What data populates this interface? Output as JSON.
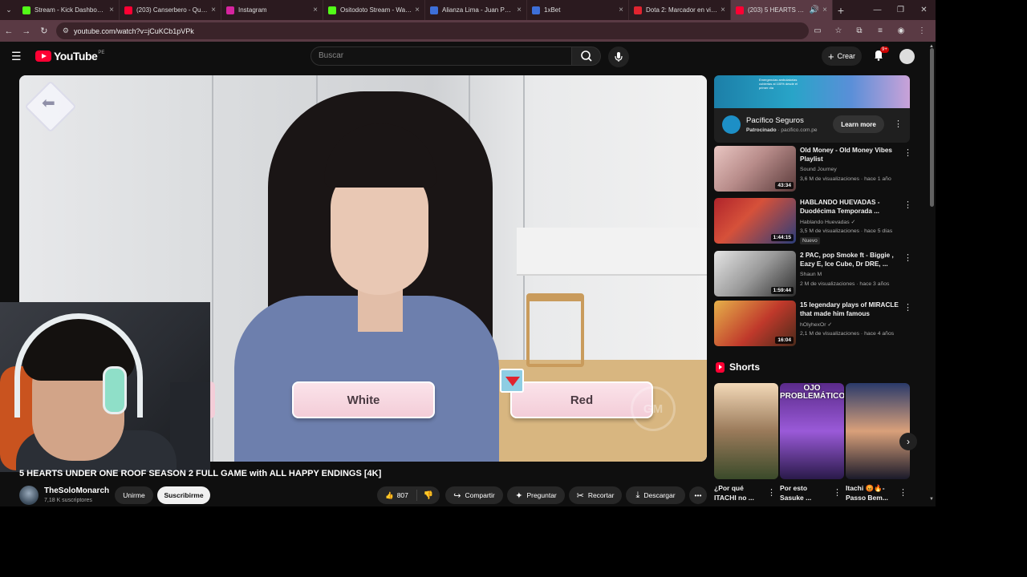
{
  "browser": {
    "tabs": [
      {
        "title": "Stream - Kick Dashboard",
        "icon": "kick-icon",
        "color": "#53fc18"
      },
      {
        "title": "(203) Canserbero - Quer...",
        "icon": "youtube-icon",
        "color": "#ff0033"
      },
      {
        "title": "Instagram",
        "icon": "instagram-icon",
        "color": "#d6249f"
      },
      {
        "title": "Ositodoto Stream - Watc...",
        "icon": "kick-icon",
        "color": "#53fc18"
      },
      {
        "title": "Alianza Lima - Juan Pablo...",
        "icon": "site-icon",
        "color": "#3d6fd8"
      },
      {
        "title": "1xBet",
        "icon": "site-icon",
        "color": "#3d6fd8"
      },
      {
        "title": "Dota 2: Marcador en vivo...",
        "icon": "site-icon",
        "color": "#e0242f"
      },
      {
        "title": "(203) 5 HEARTS UNDE...",
        "icon": "youtube-icon",
        "color": "#ff0033"
      }
    ],
    "url": "youtube.com/watch?v=jCuKCb1pVPk"
  },
  "yt": {
    "logo_text": "YouTube",
    "country": "PE",
    "search_placeholder": "Buscar",
    "create_label": "Crear",
    "notif_count": "9+"
  },
  "player": {
    "choice_left": "White",
    "choice_right": "Red",
    "watermark": "GM"
  },
  "video": {
    "title": "5 HEARTS UNDER ONE ROOF SEASON 2 FULL GAME with ALL HAPPY ENDINGS [4K]",
    "channel": "TheSoloMonarch",
    "subs": "7,18 K suscriptores",
    "join": "Unirme",
    "subscribe": "Suscribirme",
    "likes": "807",
    "share": "Compartir",
    "ask": "Preguntar",
    "clip": "Recortar",
    "download": "Descargar"
  },
  "ad": {
    "title": "Pacífico Seguros",
    "sponsored": "Patrocinado",
    "domain": "pacifico.com.pe",
    "cta": "Learn more",
    "banner_text": "Emergencias ambulatorias cubiertas al 100% desde el primer día"
  },
  "recs": [
    {
      "title": "Old Money - Old Money Vibes Playlist",
      "channel": "Sound Journey",
      "meta": "3,6 M de visualizaciones · hace 1 año",
      "duration": "43:34",
      "badge": ""
    },
    {
      "title": "HABLANDO HUEVADAS - Duodécima Temporada ...",
      "channel": "Hablando Huevadas ✓",
      "meta": "3,5 M de visualizaciones · hace 5 días",
      "duration": "1:44:15",
      "badge": "Nuevo"
    },
    {
      "title": "2 PAC, pop Smoke ft - Biggie , Eazy E, Ice Cube, Dr DRE, ...",
      "channel": "Shaun M",
      "meta": "2 M de visualizaciones · hace 3 años",
      "duration": "1:59:44",
      "badge": ""
    },
    {
      "title": "15 legendary plays of MIRACLE that made him famous",
      "channel": "hOlyhexOr ✓",
      "meta": "2,1 M de visualizaciones · hace 4 años",
      "duration": "16:04",
      "badge": ""
    }
  ],
  "shorts": {
    "heading": "Shorts",
    "items": [
      {
        "title": "¿Por qué ITACHI no ..."
      },
      {
        "title": "Por esto Sasuke ...",
        "overlay": "OJO PROBLEMÁTICO"
      },
      {
        "title": "Itachi 😡🔥- Passo Bem..."
      }
    ]
  }
}
